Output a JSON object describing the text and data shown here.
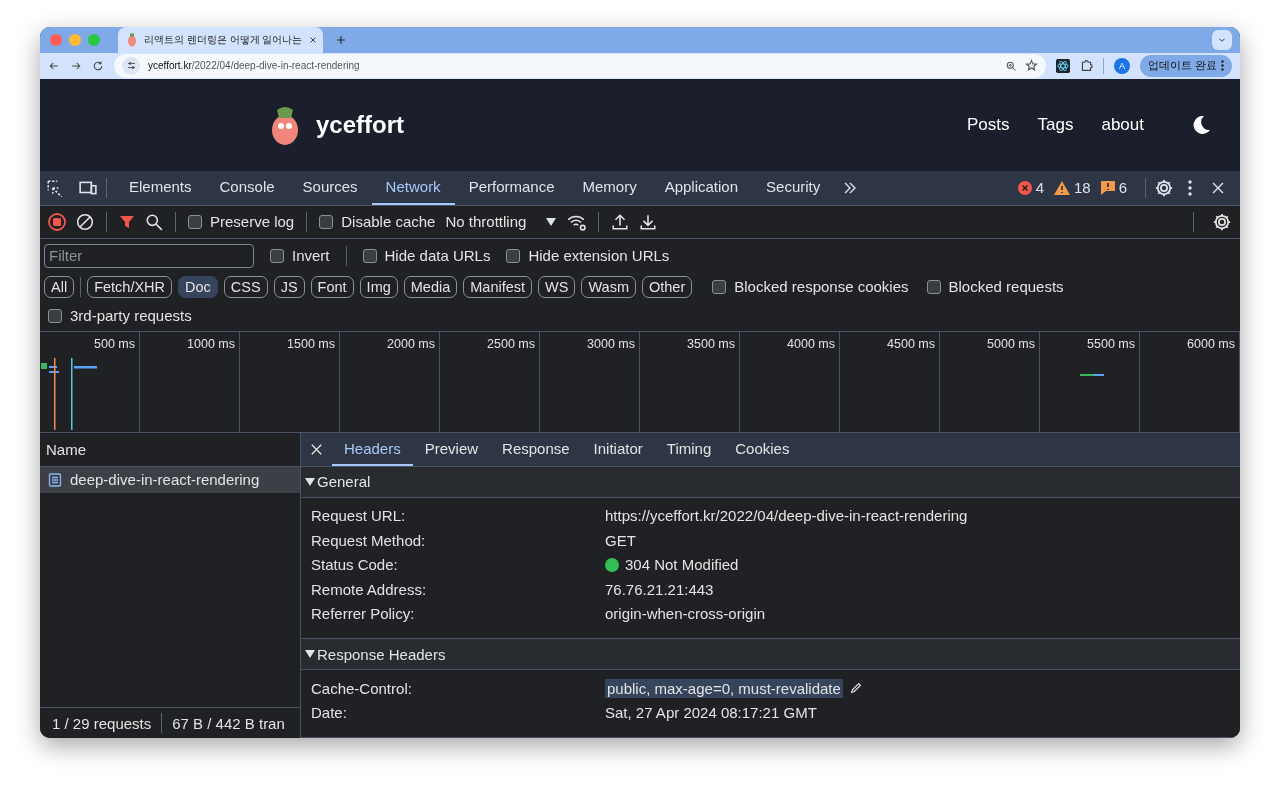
{
  "browser": {
    "tab": {
      "title": "리액트의 렌더링은 어떻게 일어나는"
    },
    "url": {
      "host": "yceffort.kr",
      "path": "/2022/04/deep-dive-in-react-rendering"
    },
    "profile": "A",
    "update_button": "업데이트 완료"
  },
  "site": {
    "brand": "yceffort",
    "nav": [
      "Posts",
      "Tags",
      "about"
    ]
  },
  "devtools": {
    "panels": [
      {
        "label": "Elements",
        "selected": false
      },
      {
        "label": "Console",
        "selected": false
      },
      {
        "label": "Sources",
        "selected": false
      },
      {
        "label": "Network",
        "selected": true
      },
      {
        "label": "Performance",
        "selected": false
      },
      {
        "label": "Memory",
        "selected": false
      },
      {
        "label": "Application",
        "selected": false
      },
      {
        "label": "Security",
        "selected": false
      }
    ],
    "counts": {
      "errors": "4",
      "warnings": "18",
      "issues": "6"
    },
    "toolbar": {
      "recording": true,
      "checkboxes": [
        {
          "label": "Preserve log",
          "checked": false
        },
        {
          "label": "Disable cache",
          "checked": false
        }
      ],
      "throttling": "No throttling"
    },
    "filter": {
      "placeholder": "Filter",
      "checkboxes": [
        {
          "label": "Invert",
          "checked": false
        },
        {
          "label": "Hide data URLs",
          "checked": false
        },
        {
          "label": "Hide extension URLs",
          "checked": false
        }
      ]
    }
  },
  "types": [
    {
      "label": "All",
      "selected": false
    },
    {
      "label": "Fetch/XHR",
      "selected": false
    },
    {
      "label": "Doc",
      "selected": true
    },
    {
      "label": "CSS",
      "selected": false
    },
    {
      "label": "JS",
      "selected": false
    },
    {
      "label": "Font",
      "selected": false
    },
    {
      "label": "Img",
      "selected": false
    },
    {
      "label": "Media",
      "selected": false
    },
    {
      "label": "Manifest",
      "selected": false
    },
    {
      "label": "WS",
      "selected": false
    },
    {
      "label": "Wasm",
      "selected": false
    },
    {
      "label": "Other",
      "selected": false
    }
  ],
  "type_checkboxes": [
    {
      "label": "Blocked response cookies",
      "checked": false
    },
    {
      "label": "Blocked requests",
      "checked": false
    }
  ],
  "third_party": {
    "label": "3rd-party requests",
    "checked": false
  },
  "timeline_ticks": [
    "500 ms",
    "1000 ms",
    "1500 ms",
    "2000 ms",
    "2500 ms",
    "3000 ms",
    "3500 ms",
    "4000 ms",
    "4500 ms",
    "5000 ms",
    "5500 ms",
    "6000 ms"
  ],
  "requests": {
    "column": "Name",
    "rows": [
      {
        "name": "deep-dive-in-react-rendering",
        "selected": true
      }
    ],
    "footer": [
      "1 / 29 requests",
      "67 B / 442 B tran"
    ]
  },
  "details": {
    "tabs": [
      {
        "label": "Headers",
        "selected": true
      },
      {
        "label": "Preview",
        "selected": false
      },
      {
        "label": "Response",
        "selected": false
      },
      {
        "label": "Initiator",
        "selected": false
      },
      {
        "label": "Timing",
        "selected": false
      },
      {
        "label": "Cookies",
        "selected": false
      }
    ],
    "sections": [
      {
        "title": "General",
        "expanded": true,
        "rows": [
          {
            "label": "Request URL:",
            "value": "https://yceffort.kr/2022/04/deep-dive-in-react-rendering",
            "highlighted": false
          },
          {
            "label": "Request Method:",
            "value": "GET",
            "highlighted": false
          },
          {
            "label": "Status Code:",
            "value": "304 Not Modified",
            "color": "#2fbf54",
            "highlighted": false
          },
          {
            "label": "Remote Address:",
            "value": "76.76.21.21:443",
            "highlighted": false
          },
          {
            "label": "Referrer Policy:",
            "value": "origin-when-cross-origin",
            "highlighted": false
          }
        ]
      },
      {
        "title": "Response Headers",
        "expanded": true,
        "rows": [
          {
            "label": "Cache-Control:",
            "value": "public, max-age=0, must-revalidate",
            "highlighted": true
          },
          {
            "label": "Date:",
            "value": "Sat, 27 Apr 2024 08:17:21 GMT",
            "highlighted": false
          }
        ]
      }
    ]
  }
}
